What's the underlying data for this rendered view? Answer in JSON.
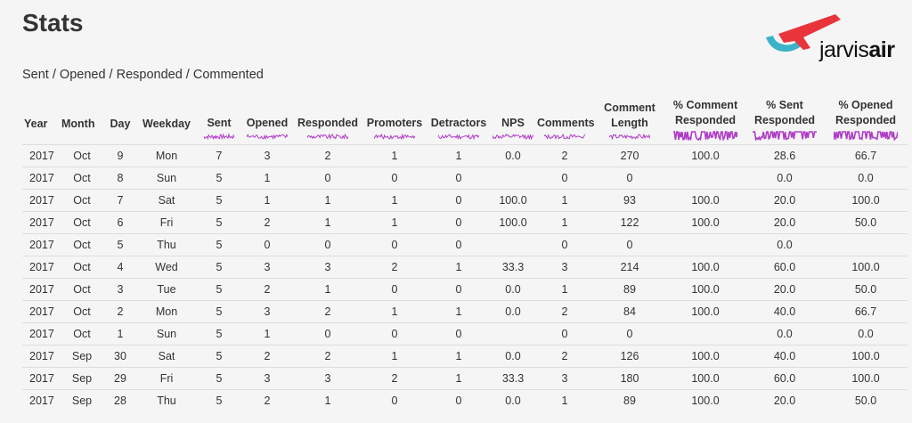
{
  "page": {
    "title": "Stats",
    "subtitle": "Sent / Opened / Responded / Commented"
  },
  "logo": {
    "text_light": "jarvis",
    "text_bold": "air",
    "colors": {
      "red": "#e8343a",
      "teal": "#3ab3c8"
    }
  },
  "colors": {
    "sparkline": "#b03cc8",
    "border": "#dddddd",
    "background": "#f5f5f5"
  },
  "table": {
    "headers": [
      {
        "key": "year",
        "label": "Year",
        "spark": false
      },
      {
        "key": "month",
        "label": "Month",
        "spark": false
      },
      {
        "key": "day",
        "label": "Day",
        "spark": false
      },
      {
        "key": "weekday",
        "label": "Weekday",
        "spark": false
      },
      {
        "key": "sent",
        "label": "Sent",
        "spark": true,
        "spark_icon": "sparkline-sent-icon"
      },
      {
        "key": "opened",
        "label": "Opened",
        "spark": true,
        "spark_icon": "sparkline-opened-icon"
      },
      {
        "key": "responded",
        "label": "Responded",
        "spark": true,
        "spark_icon": "sparkline-responded-icon"
      },
      {
        "key": "promoters",
        "label": "Promoters",
        "spark": true,
        "spark_icon": "sparkline-promoters-icon"
      },
      {
        "key": "detractors",
        "label": "Detractors",
        "spark": true,
        "spark_icon": "sparkline-detractors-icon"
      },
      {
        "key": "nps",
        "label": "NPS",
        "spark": true,
        "spark_icon": "sparkline-nps-icon"
      },
      {
        "key": "comments",
        "label": "Comments",
        "spark": true,
        "spark_icon": "sparkline-comments-icon"
      },
      {
        "key": "comment_length",
        "label": "Comment Length",
        "spark": true,
        "spark_icon": "sparkline-comment-length-icon"
      },
      {
        "key": "pct_comment_responded",
        "label": "% Comment Responded",
        "spark": true,
        "spark_icon": "sparkline-pct-comment-responded-icon"
      },
      {
        "key": "pct_sent_responded",
        "label": "% Sent Responded",
        "spark": true,
        "spark_icon": "sparkline-pct-sent-responded-icon"
      },
      {
        "key": "pct_opened_responded",
        "label": "% Opened Responded",
        "spark": true,
        "spark_icon": "sparkline-pct-opened-responded-icon"
      }
    ],
    "rows": [
      [
        "2017",
        "Oct",
        "9",
        "Mon",
        "7",
        "3",
        "2",
        "1",
        "1",
        "0.0",
        "2",
        "270",
        "100.0",
        "28.6",
        "66.7"
      ],
      [
        "2017",
        "Oct",
        "8",
        "Sun",
        "5",
        "1",
        "0",
        "0",
        "0",
        "",
        "0",
        "0",
        "",
        "0.0",
        "0.0"
      ],
      [
        "2017",
        "Oct",
        "7",
        "Sat",
        "5",
        "1",
        "1",
        "1",
        "0",
        "100.0",
        "1",
        "93",
        "100.0",
        "20.0",
        "100.0"
      ],
      [
        "2017",
        "Oct",
        "6",
        "Fri",
        "5",
        "2",
        "1",
        "1",
        "0",
        "100.0",
        "1",
        "122",
        "100.0",
        "20.0",
        "50.0"
      ],
      [
        "2017",
        "Oct",
        "5",
        "Thu",
        "5",
        "0",
        "0",
        "0",
        "0",
        "",
        "0",
        "0",
        "",
        "0.0",
        ""
      ],
      [
        "2017",
        "Oct",
        "4",
        "Wed",
        "5",
        "3",
        "3",
        "2",
        "1",
        "33.3",
        "3",
        "214",
        "100.0",
        "60.0",
        "100.0"
      ],
      [
        "2017",
        "Oct",
        "3",
        "Tue",
        "5",
        "2",
        "1",
        "0",
        "0",
        "0.0",
        "1",
        "89",
        "100.0",
        "20.0",
        "50.0"
      ],
      [
        "2017",
        "Oct",
        "2",
        "Mon",
        "5",
        "3",
        "2",
        "1",
        "1",
        "0.0",
        "2",
        "84",
        "100.0",
        "40.0",
        "66.7"
      ],
      [
        "2017",
        "Oct",
        "1",
        "Sun",
        "5",
        "1",
        "0",
        "0",
        "0",
        "",
        "0",
        "0",
        "",
        "0.0",
        "0.0"
      ],
      [
        "2017",
        "Sep",
        "30",
        "Sat",
        "5",
        "2",
        "2",
        "1",
        "1",
        "0.0",
        "2",
        "126",
        "100.0",
        "40.0",
        "100.0"
      ],
      [
        "2017",
        "Sep",
        "29",
        "Fri",
        "5",
        "3",
        "3",
        "2",
        "1",
        "33.3",
        "3",
        "180",
        "100.0",
        "60.0",
        "100.0"
      ],
      [
        "2017",
        "Sep",
        "28",
        "Thu",
        "5",
        "2",
        "1",
        "0",
        "0",
        "0.0",
        "1",
        "89",
        "100.0",
        "20.0",
        "50.0"
      ]
    ]
  }
}
